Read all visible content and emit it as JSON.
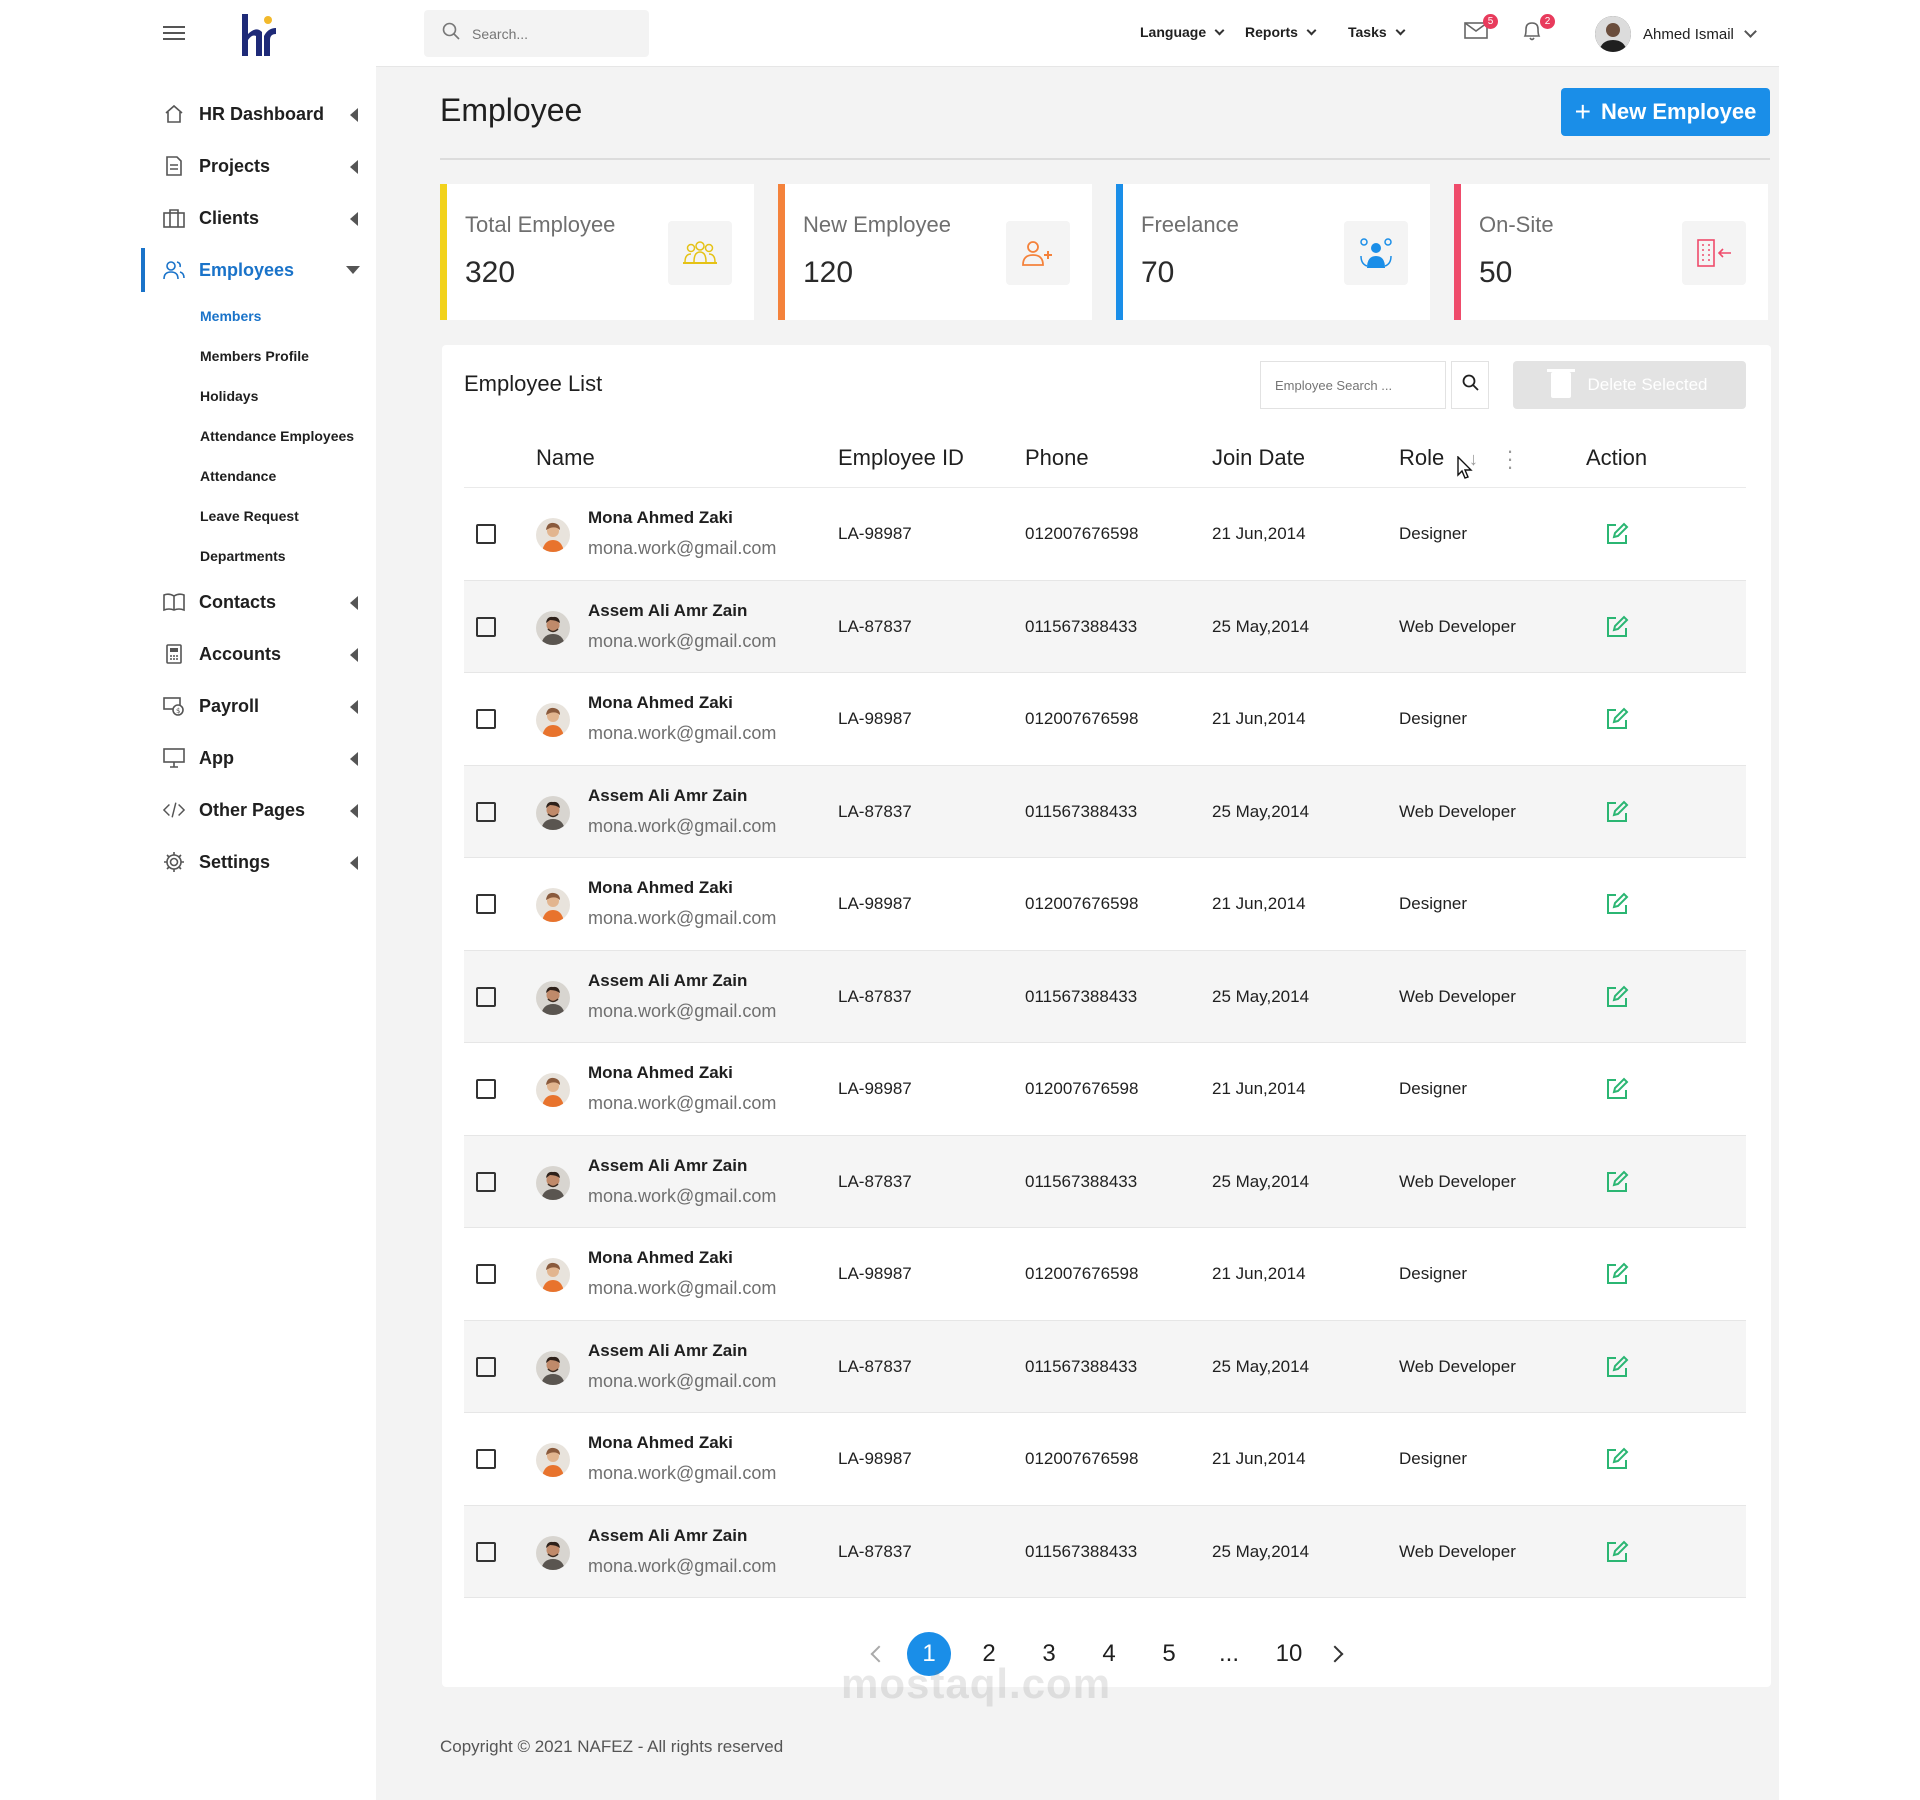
{
  "app": {
    "logo_text": "hr",
    "colors": {
      "accent": "#1a8ee8",
      "active_nav": "#1a73c9",
      "sidebar_bg": "#ffffff",
      "page_bg": "#f3f3f3"
    }
  },
  "topbar": {
    "search_placeholder": "Search...",
    "menus": [
      "Language",
      "Reports",
      "Tasks"
    ],
    "mail_badge": "5",
    "notif_badge": "2",
    "user_name": "Ahmed Ismail"
  },
  "sidebar": {
    "items": [
      {
        "label": "HR Dashboard",
        "icon": "home-icon"
      },
      {
        "label": "Projects",
        "icon": "document-icon"
      },
      {
        "label": "Clients",
        "icon": "briefcase-icon"
      },
      {
        "label": "Employees",
        "icon": "users-icon",
        "active": true
      },
      {
        "label": "Contacts",
        "icon": "book-icon"
      },
      {
        "label": "Accounts",
        "icon": "calculator-icon"
      },
      {
        "label": "Payroll",
        "icon": "money-icon"
      },
      {
        "label": "App",
        "icon": "monitor-icon"
      },
      {
        "label": "Other Pages",
        "icon": "code-icon"
      },
      {
        "label": "Settings",
        "icon": "gear-icon"
      }
    ],
    "sub_items": [
      "Members",
      "Members Profile",
      "Holidays",
      "Attendance Employees",
      "Attendance",
      "Leave Request",
      "Departments"
    ]
  },
  "page": {
    "title": "Employee",
    "new_button": "New Employee"
  },
  "stats": [
    {
      "label": "Total Employee",
      "value": "320",
      "color": "#f2d21b",
      "icon": "group-icon"
    },
    {
      "label": "New Employee",
      "value": "120",
      "color": "#f4823b",
      "icon": "add-user-icon"
    },
    {
      "label": "Freelance",
      "value": "70",
      "color": "#1a8ee8",
      "icon": "freelancer-icon"
    },
    {
      "label": "On-Site",
      "value": "50",
      "color": "#ef4b6b",
      "icon": "building-icon"
    }
  ],
  "list": {
    "title": "Employee List",
    "search_placeholder": "Employee Search ...",
    "delete_label": "Delete Selected",
    "columns": [
      "Name",
      "Employee ID",
      "Phone",
      "Join Date",
      "Role",
      "Action"
    ],
    "rows": [
      {
        "name": "Mona Ahmed Zaki",
        "email": "mona.work@gmail.com",
        "id": "LA-98987",
        "phone": "012007676598",
        "date": "21 Jun,2014",
        "role": "Designer"
      },
      {
        "name": "Assem Ali Amr Zain",
        "email": "mona.work@gmail.com",
        "id": "LA-87837",
        "phone": "011567388433",
        "date": "25 May,2014",
        "role": "Web Developer"
      },
      {
        "name": "Mona Ahmed Zaki",
        "email": "mona.work@gmail.com",
        "id": "LA-98987",
        "phone": "012007676598",
        "date": "21 Jun,2014",
        "role": "Designer"
      },
      {
        "name": "Assem Ali Amr Zain",
        "email": "mona.work@gmail.com",
        "id": "LA-87837",
        "phone": "011567388433",
        "date": "25 May,2014",
        "role": "Web Developer"
      },
      {
        "name": "Mona Ahmed Zaki",
        "email": "mona.work@gmail.com",
        "id": "LA-98987",
        "phone": "012007676598",
        "date": "21 Jun,2014",
        "role": "Designer"
      },
      {
        "name": "Assem Ali Amr Zain",
        "email": "mona.work@gmail.com",
        "id": "LA-87837",
        "phone": "011567388433",
        "date": "25 May,2014",
        "role": "Web Developer"
      },
      {
        "name": "Mona Ahmed Zaki",
        "email": "mona.work@gmail.com",
        "id": "LA-98987",
        "phone": "012007676598",
        "date": "21 Jun,2014",
        "role": "Designer"
      },
      {
        "name": "Assem Ali Amr Zain",
        "email": "mona.work@gmail.com",
        "id": "LA-87837",
        "phone": "011567388433",
        "date": "25 May,2014",
        "role": "Web Developer"
      },
      {
        "name": "Mona Ahmed Zaki",
        "email": "mona.work@gmail.com",
        "id": "LA-98987",
        "phone": "012007676598",
        "date": "21 Jun,2014",
        "role": "Designer"
      },
      {
        "name": "Assem Ali Amr Zain",
        "email": "mona.work@gmail.com",
        "id": "LA-87837",
        "phone": "011567388433",
        "date": "25 May,2014",
        "role": "Web Developer"
      },
      {
        "name": "Mona Ahmed Zaki",
        "email": "mona.work@gmail.com",
        "id": "LA-98987",
        "phone": "012007676598",
        "date": "21 Jun,2014",
        "role": "Designer"
      },
      {
        "name": "Assem Ali Amr Zain",
        "email": "mona.work@gmail.com",
        "id": "LA-87837",
        "phone": "011567388433",
        "date": "25 May,2014",
        "role": "Web Developer"
      }
    ]
  },
  "pagination": {
    "pages": [
      "1",
      "2",
      "3",
      "4",
      "5",
      "...",
      "10"
    ],
    "current": "1"
  },
  "footer": {
    "copyright": "Copyright © 2021 NAFEZ - All rights reserved"
  },
  "watermark": "mostaql.com"
}
